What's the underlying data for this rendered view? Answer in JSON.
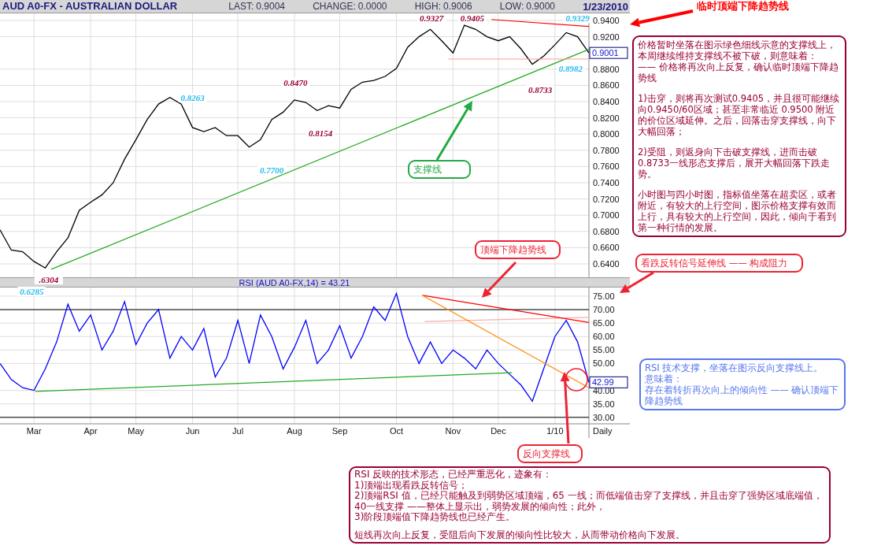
{
  "header": {
    "title": "AUD A0-FX - AUSTRALIAN DOLLAR",
    "fields": [
      {
        "label": "LAST:",
        "value": "0.9004"
      },
      {
        "label": "CHANGE:",
        "value": "0.0000"
      },
      {
        "label": "HIGH:",
        "value": "0.9006"
      },
      {
        "label": "LOW:",
        "value": "0.9000"
      }
    ],
    "date": "1/23/2010"
  },
  "price_chart": {
    "chart_data": {
      "type": "line",
      "grid": true,
      "ylim": [
        0.6235,
        0.9487
      ],
      "yticks": [
        {
          "value": 0.64,
          "label": "0.6400"
        },
        {
          "value": 0.66,
          "label": "0.6600"
        },
        {
          "value": 0.68,
          "label": "0.6800"
        },
        {
          "value": 0.7,
          "label": "0.7000"
        },
        {
          "value": 0.72,
          "label": "0.7200"
        },
        {
          "value": 0.74,
          "label": "0.7400"
        },
        {
          "value": 0.76,
          "label": "0.7600"
        },
        {
          "value": 0.78,
          "label": "0.7800"
        },
        {
          "value": 0.8,
          "label": "0.8000"
        },
        {
          "value": 0.82,
          "label": "0.8200"
        },
        {
          "value": 0.84,
          "label": "0.8400"
        },
        {
          "value": 0.86,
          "label": "0.8600"
        },
        {
          "value": 0.88,
          "label": "0.8800"
        },
        {
          "value": 0.92,
          "label": "0.9200"
        },
        {
          "value": 0.94,
          "label": "0.9400"
        }
      ],
      "series": [
        {
          "color": "#000000",
          "values": [
            0.682,
            0.657,
            0.655,
            0.643,
            0.635,
            0.655,
            0.672,
            0.706,
            0.716,
            0.725,
            0.74,
            0.769,
            0.793,
            0.818,
            0.837,
            0.845,
            0.837,
            0.808,
            0.803,
            0.808,
            0.798,
            0.798,
            0.784,
            0.793,
            0.818,
            0.827,
            0.842,
            0.839,
            0.829,
            0.835,
            0.832,
            0.855,
            0.864,
            0.866,
            0.871,
            0.881,
            0.907,
            0.92,
            0.929,
            0.915,
            0.9,
            0.934,
            0.929,
            0.92,
            0.915,
            0.92,
            0.905,
            0.886,
            0.896,
            0.91,
            0.925,
            0.92,
            0.9
          ]
        }
      ],
      "annotations": [
        "0.9327",
        "0.9405",
        "0.9329",
        "0.8982",
        "0.8733",
        "0.8470",
        "0.8263",
        "0.8154",
        "0.7700",
        ".6304",
        "0.6285"
      ]
    },
    "current": "0.9001"
  },
  "rsi_chart": {
    "chart_data": {
      "type": "line",
      "title": "RSI (AUD A0-FX,14) = 43.21",
      "xlabel": "Daily",
      "grid": true,
      "categories": [
        null,
        null,
        null,
        "Mar",
        null,
        null,
        null,
        null,
        "Apr",
        null,
        null,
        null,
        "May",
        null,
        null,
        null,
        null,
        "Jun",
        null,
        null,
        null,
        "Jul",
        null,
        null,
        null,
        null,
        "Aug",
        null,
        null,
        null,
        "Sep",
        null,
        null,
        null,
        null,
        "Oct",
        null,
        null,
        null,
        null,
        "Nov",
        null,
        null,
        null,
        "Dec",
        null,
        null,
        null,
        null,
        "1/10",
        null,
        null,
        null
      ],
      "ylim": [
        27.6,
        78.2
      ],
      "yticks": [
        {
          "value": 30,
          "label": "30.00"
        },
        {
          "value": 35,
          "label": "35.00"
        },
        {
          "value": 40,
          "label": "40.00"
        },
        {
          "value": 50,
          "label": "50.00"
        },
        {
          "value": 55,
          "label": "55.00"
        },
        {
          "value": 60,
          "label": "60.00"
        },
        {
          "value": 65,
          "label": "65.00"
        },
        {
          "value": 70,
          "label": "70.00"
        },
        {
          "value": 75,
          "label": "75.00"
        }
      ],
      "series": [
        {
          "color": "#0000ff",
          "values": [
            50,
            44,
            41,
            40,
            48,
            58,
            72,
            62,
            68,
            55,
            62,
            73,
            57,
            65,
            70,
            52,
            60,
            55,
            63,
            45,
            52,
            66,
            50,
            68,
            60,
            48,
            56,
            66,
            50,
            55,
            64,
            52,
            60,
            71,
            66,
            76,
            60,
            50,
            58,
            50,
            55,
            52,
            48,
            55,
            50,
            46,
            42,
            36,
            48,
            60,
            66,
            58,
            43
          ]
        }
      ]
    },
    "current": "42.99"
  },
  "callouts": [
    {
      "kind": "label",
      "color": "#ff0000",
      "blocks": [
        [
          "临时顶端下降趋势线"
        ]
      ]
    },
    {
      "kind": "box",
      "color": "#990033",
      "blocks": [
        [
          "价格暂时坐落在图示绿色细线示意的支撑线上，本周继续维持支撑线不被下破，则意味着：",
          "—— 价格将再次向上反复，确认临时顶端下降趋势线"
        ],
        [
          "1)击穿，则将再次测试0.9405，并且很可能继续向0.9450/60区域；甚至非常临近 0.9500 附近的价位区域延伸。之后，回落击穿支撑线，向下大幅回落；"
        ],
        [
          "2)受阻，则返身向下击破支撑线，进而击破0.8733一线形态支撑后，展开大幅回落下跌走势。"
        ],
        [
          "小时图与四小时图，指标值坐落在超卖区，或者附近，有较大的上行空间，图示价格支撑有效而上行，具有较大的上行空间，因此，倾向于看到第一种行情的发展。"
        ]
      ]
    },
    {
      "kind": "box",
      "color": "#22aa44",
      "blocks": [
        [
          "支撑线"
        ]
      ]
    },
    {
      "kind": "box",
      "color": "#ee2233",
      "blocks": [
        [
          "顶端下降趋势线"
        ]
      ]
    },
    {
      "kind": "box",
      "color": "#ee2233",
      "blocks": [
        [
          "看跌反转信号延伸线 —— 构成阻力"
        ]
      ]
    },
    {
      "kind": "box",
      "color": "#ee2233",
      "blocks": [
        [
          "反向支撑线"
        ]
      ]
    },
    {
      "kind": "box",
      "color": "#5577ee",
      "blocks": [
        [
          "RSI 技术支撑，坐落在图示反向支撑线上。",
          "意味着：",
          "存在着转折再次向上的倾向性 —— 确认顶端下降趋势线"
        ]
      ]
    },
    {
      "kind": "box",
      "color": "#990033",
      "blocks": [
        [
          "RSI 反映的技术形态，已经严重恶化，迹象有：",
          "1)顶端出现看跌反转信号；",
          "2)顶端RSI 值，已经只能触及到弱势区域顶端，65 一线；而低端值击穿了支撑线，并且击穿了强势区域底端值，40一线支撑 ——整体上显示出，弱势发展的倾向性；此外，",
          "3)阶段顶端值下降趋势线也已经产生。"
        ],
        [
          "短线再次向上反复，受阻后向下发展的倾向性比较大，从而带动价格向下发展。"
        ]
      ]
    }
  ]
}
